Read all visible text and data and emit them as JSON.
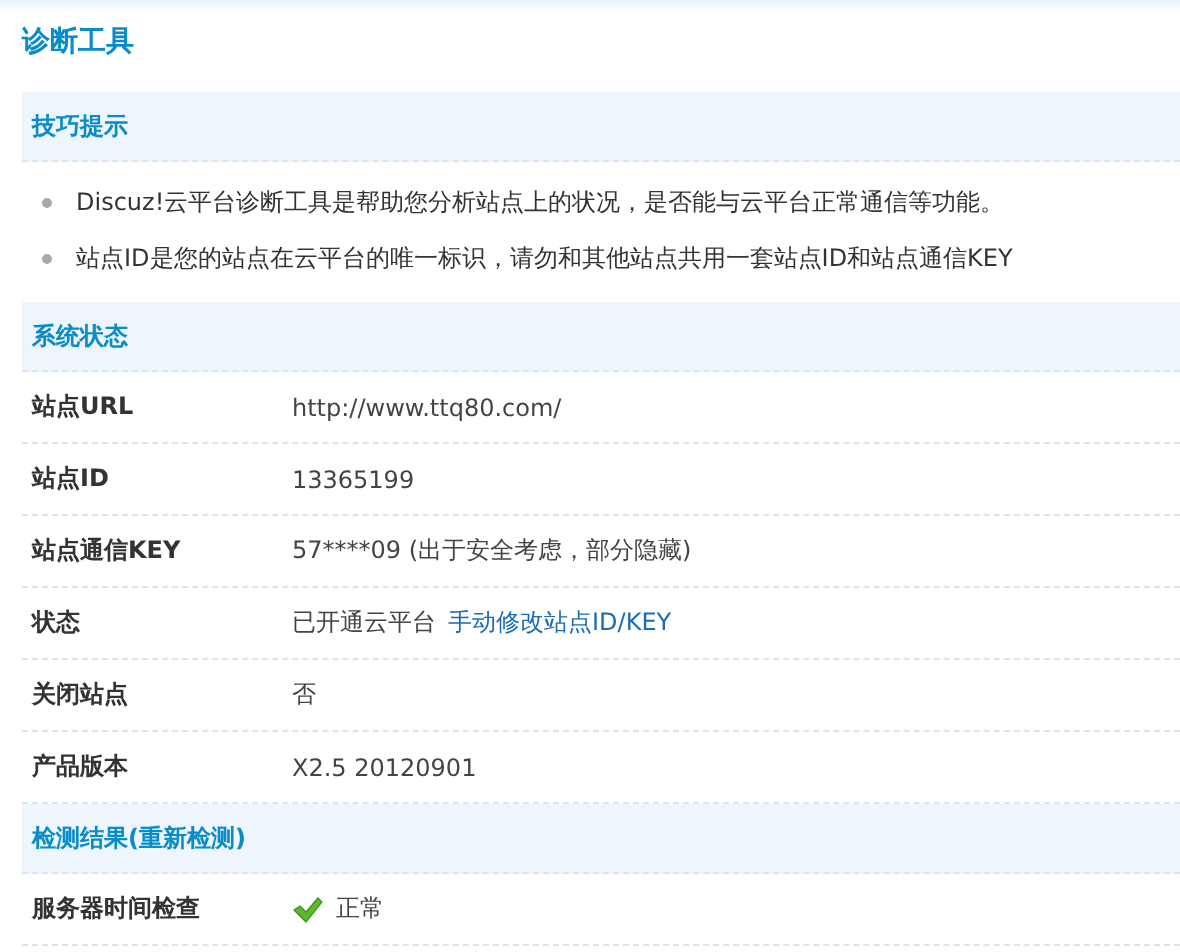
{
  "title": "诊断工具",
  "sections": [
    {
      "kind": "tips",
      "heading": "技巧提示",
      "items": [
        "Discuz!云平台诊断工具是帮助您分析站点上的状况，是否能与云平台正常通信等功能。",
        "站点ID是您的站点在云平台的唯一标识，请勿和其他站点共用一套站点ID和站点通信KEY"
      ]
    },
    {
      "kind": "table",
      "heading": "系统状态",
      "rows": [
        {
          "label": "站点URL",
          "value": "http://www.ttq80.com/"
        },
        {
          "label": "站点ID",
          "value": "13365199"
        },
        {
          "label": "站点通信KEY",
          "value": "57****09 (出于安全考虑，部分隐藏)"
        },
        {
          "label": "状态",
          "value": "已开通云平台",
          "link": "手动修改站点ID/KEY"
        },
        {
          "label": "关闭站点",
          "value": "否"
        },
        {
          "label": "产品版本",
          "value": "X2.5 20120901"
        }
      ]
    },
    {
      "kind": "table",
      "heading": "检测结果(重新检测)",
      "rows": [
        {
          "label": "服务器时间检查",
          "value": "正常",
          "passed": true
        }
      ]
    }
  ]
}
